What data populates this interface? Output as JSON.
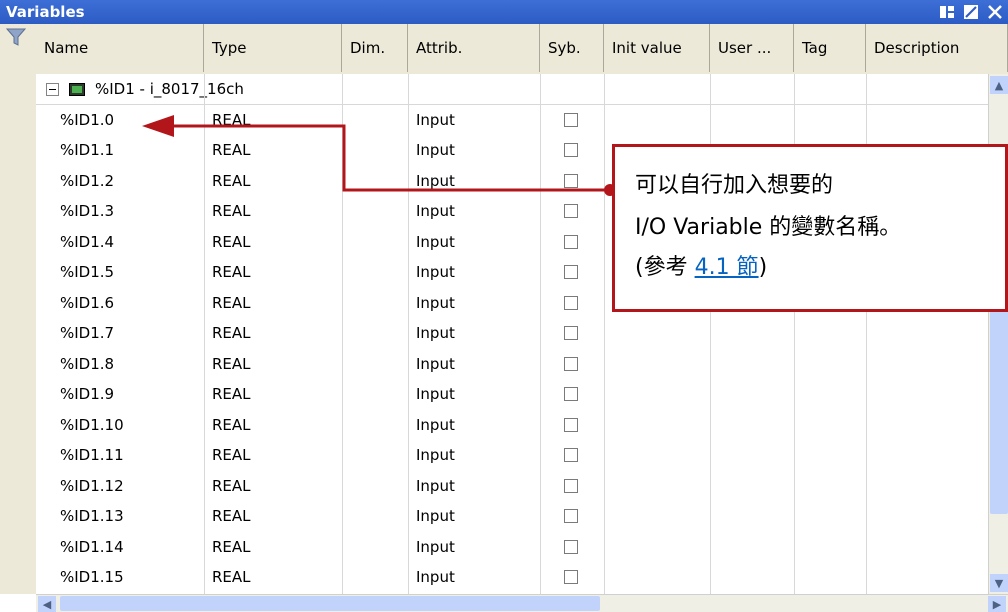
{
  "window": {
    "title": "Variables"
  },
  "toolbar_icons": [
    "dock-icon",
    "edit-icon",
    "close-icon"
  ],
  "columns": [
    {
      "key": "name",
      "label": "Name"
    },
    {
      "key": "type",
      "label": "Type"
    },
    {
      "key": "dim",
      "label": "Dim."
    },
    {
      "key": "attrib",
      "label": "Attrib."
    },
    {
      "key": "syb",
      "label": "Syb."
    },
    {
      "key": "init",
      "label": "Init value"
    },
    {
      "key": "user",
      "label": "User ..."
    },
    {
      "key": "tag",
      "label": "Tag"
    },
    {
      "key": "desc",
      "label": "Description"
    }
  ],
  "group": {
    "label": "%ID1 - i_8017_16ch"
  },
  "rows": [
    {
      "name": "%ID1.0",
      "type": "REAL",
      "attrib": "Input"
    },
    {
      "name": "%ID1.1",
      "type": "REAL",
      "attrib": "Input"
    },
    {
      "name": "%ID1.2",
      "type": "REAL",
      "attrib": "Input"
    },
    {
      "name": "%ID1.3",
      "type": "REAL",
      "attrib": "Input"
    },
    {
      "name": "%ID1.4",
      "type": "REAL",
      "attrib": "Input"
    },
    {
      "name": "%ID1.5",
      "type": "REAL",
      "attrib": "Input"
    },
    {
      "name": "%ID1.6",
      "type": "REAL",
      "attrib": "Input"
    },
    {
      "name": "%ID1.7",
      "type": "REAL",
      "attrib": "Input"
    },
    {
      "name": "%ID1.8",
      "type": "REAL",
      "attrib": "Input"
    },
    {
      "name": "%ID1.9",
      "type": "REAL",
      "attrib": "Input"
    },
    {
      "name": "%ID1.10",
      "type": "REAL",
      "attrib": "Input"
    },
    {
      "name": "%ID1.11",
      "type": "REAL",
      "attrib": "Input"
    },
    {
      "name": "%ID1.12",
      "type": "REAL",
      "attrib": "Input"
    },
    {
      "name": "%ID1.13",
      "type": "REAL",
      "attrib": "Input"
    },
    {
      "name": "%ID1.14",
      "type": "REAL",
      "attrib": "Input"
    },
    {
      "name": "%ID1.15",
      "type": "REAL",
      "attrib": "Input"
    }
  ],
  "callout": {
    "line1": "可以自行加入想要的",
    "line2": "I/O Variable 的變數名稱。",
    "line3_prefix": "(參考 ",
    "line3_link": "4.1 節",
    "line3_suffix": ")"
  },
  "colors": {
    "titlebar": "#2c5bc4",
    "header_bg": "#ece9d8",
    "callout_border": "#b3161a",
    "link": "#0563c1"
  }
}
